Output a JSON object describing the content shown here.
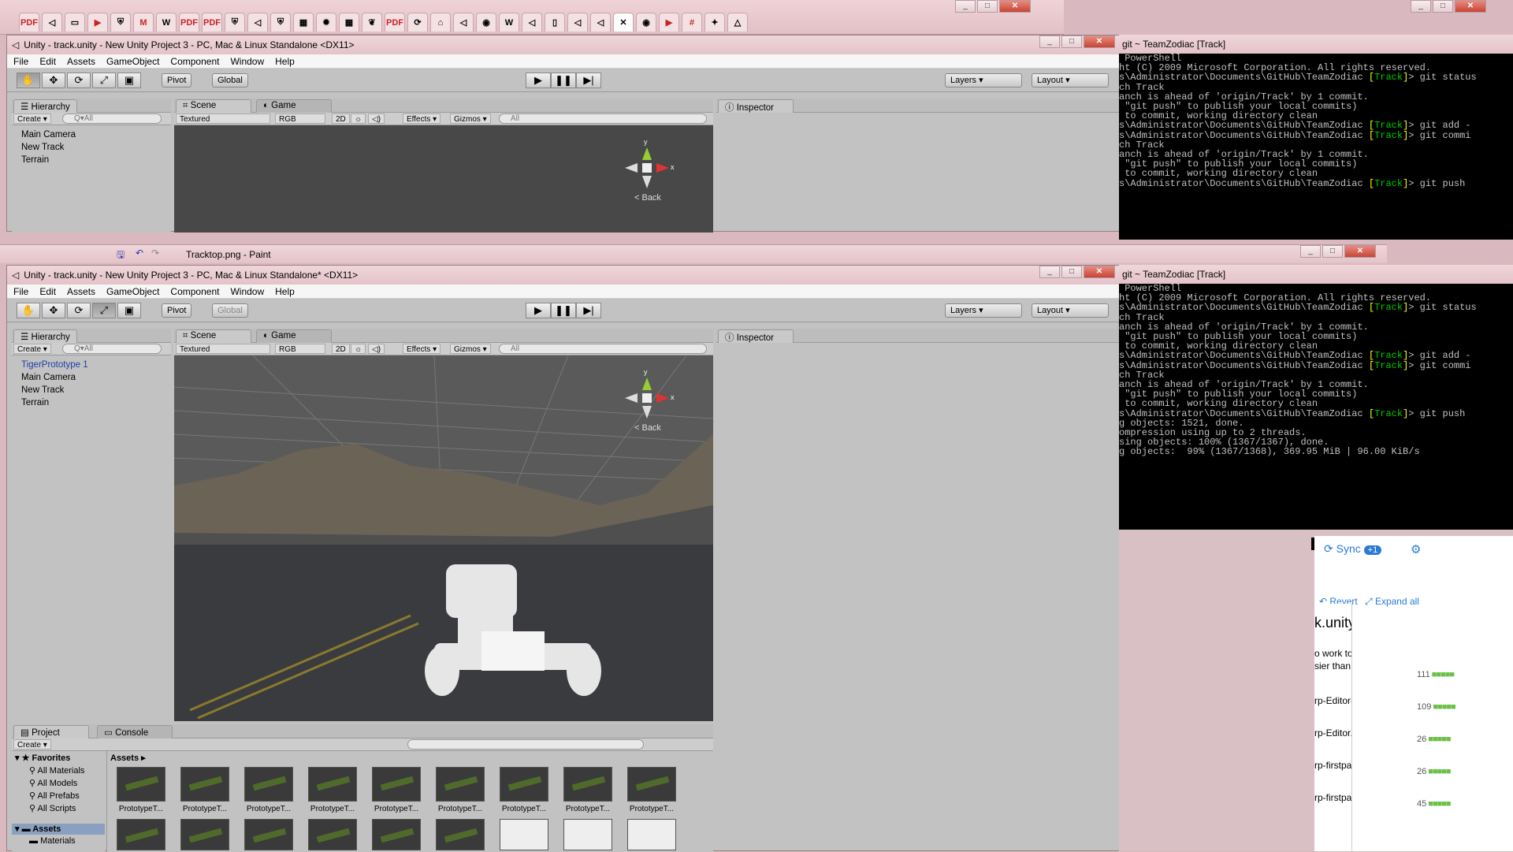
{
  "colors": {
    "titlebar": "#e8c8cd",
    "unity_panel": "#c2c2c2",
    "scene_dark": "#484848",
    "terminal": "#000000",
    "branch_yellow": "#ffff00",
    "branch_green": "#00cc00"
  },
  "browser_tabs": [
    "pdf",
    "unity",
    "tab",
    "youtube",
    "shield",
    "gmail",
    "wiki",
    "pdf",
    "pdf",
    "shield",
    "unity",
    "shield",
    "sheet",
    "burst",
    "sheet",
    "bird",
    "pdf",
    "sync",
    "nest",
    "unity",
    "github",
    "wiki",
    "unity",
    "doc",
    "unity",
    "unity",
    "close",
    "github",
    "youtube",
    "hash",
    "star",
    "drive"
  ],
  "top_window": {
    "title": "Unity - track.unity - New Unity Project 3 - PC, Mac & Linux Standalone <DX11>",
    "menu": [
      "File",
      "Edit",
      "Assets",
      "GameObject",
      "Component",
      "Window",
      "Help"
    ],
    "pivot": "Pivot",
    "global": "Global",
    "layers": "Layers",
    "layout": "Layout",
    "hierarchy_tab": "Hierarchy",
    "create": "Create",
    "search_all": "Q▾All",
    "hierarchy": [
      "Main Camera",
      "New Track",
      "Terrain"
    ],
    "scene_tab": "Scene",
    "game_tab": "Game",
    "textured": "Textured",
    "rgb": "RGB",
    "two_d": "2D",
    "effects": "Effects",
    "gizmos": "Gizmos",
    "inspector_tab": "Inspector",
    "gizmo_back": "< Back",
    "axis_y": "y",
    "axis_x": "x"
  },
  "paint_bar": {
    "title": "Tracktop.png - Paint"
  },
  "bottom_window": {
    "title": "Unity - track.unity - New Unity Project 3 - PC, Mac & Linux Standalone* <DX11>",
    "menu": [
      "File",
      "Edit",
      "Assets",
      "GameObject",
      "Component",
      "Window",
      "Help"
    ],
    "pivot": "Pivot",
    "global": "Global",
    "layers": "Layers",
    "layout": "Layout",
    "hierarchy_tab": "Hierarchy",
    "create": "Create",
    "search_all": "Q▾All",
    "hierarchy": [
      "TigerPrototype 1",
      "Main Camera",
      "New Track",
      "Terrain"
    ],
    "scene_tab": "Scene",
    "game_tab": "Game",
    "textured": "Textured",
    "rgb": "RGB",
    "two_d": "2D",
    "effects": "Effects",
    "gizmos": "Gizmos",
    "inspector_tab": "Inspector",
    "gizmo_back": "< Back",
    "axis_y": "y",
    "axis_x": "x",
    "project_tab": "Project",
    "console_tab": "Console",
    "favorites": "Favorites",
    "fav_items": [
      "All Materials",
      "All Models",
      "All Prefabs",
      "All Scripts"
    ],
    "assets_root": "Assets",
    "assets_sub": "Materials",
    "assets_header": "Assets ▸",
    "asset_name": "PrototypeT..."
  },
  "terminal_top": {
    "title": "git ~ TeamZodiac [Track]",
    "lines": [
      " PowerShell",
      "ht (C) 2009 Microsoft Corporation. All rights reserved.",
      "",
      "s\\Administrator\\Documents\\GitHub\\TeamZodiac [Track]> git status",
      "ch Track",
      "anch is ahead of 'origin/Track' by 1 commit.",
      " \"git push\" to publish your local commits)",
      "",
      " to commit, working directory clean",
      "s\\Administrator\\Documents\\GitHub\\TeamZodiac [Track]> git add -",
      "s\\Administrator\\Documents\\GitHub\\TeamZodiac [Track]> git commi",
      "",
      "ch Track",
      "anch is ahead of 'origin/Track' by 1 commit.",
      " \"git push\" to publish your local commits)",
      "",
      " to commit, working directory clean",
      "s\\Administrator\\Documents\\GitHub\\TeamZodiac [Track]> git push"
    ]
  },
  "terminal_bottom": {
    "title": "git ~ TeamZodiac [Track]",
    "lines": [
      " PowerShell",
      "ht (C) 2009 Microsoft Corporation. All rights reserved.",
      "",
      "s\\Administrator\\Documents\\GitHub\\TeamZodiac [Track]> git status",
      "ch Track",
      "anch is ahead of 'origin/Track' by 1 commit.",
      " \"git push\" to publish your local commits)",
      "",
      " to commit, working directory clean",
      "s\\Administrator\\Documents\\GitHub\\TeamZodiac [Track]> git add -",
      "s\\Administrator\\Documents\\GitHub\\TeamZodiac [Track]> git commi",
      "",
      "ch Track",
      "anch is ahead of 'origin/Track' by 1 commit.",
      " \"git push\" to publish your local commits)",
      "",
      " to commit, working directory clean",
      "s\\Administrator\\Documents\\GitHub\\TeamZodiac [Track]> git push",
      "g objects: 1521, done.",
      "ompression using up to 2 threads.",
      "sing objects: 100% (1367/1367), done.",
      "g objects:  99% (1367/1368), 369.95 MiB | 96.00 KiB/s"
    ]
  },
  "github": {
    "sync": "Sync",
    "sync_count": "+1",
    "revert": "Revert",
    "expand_all": "Expand all",
    "heading": "k.unity",
    "snippet1": "o work tog",
    "snippet2": "sier than th",
    "files": [
      "rp-Editor-v",
      "rp-Editor.cs",
      "rp-firstpass",
      "rp-firstpass"
    ],
    "counts": [
      "111",
      "109",
      "26",
      "26",
      "45"
    ]
  }
}
